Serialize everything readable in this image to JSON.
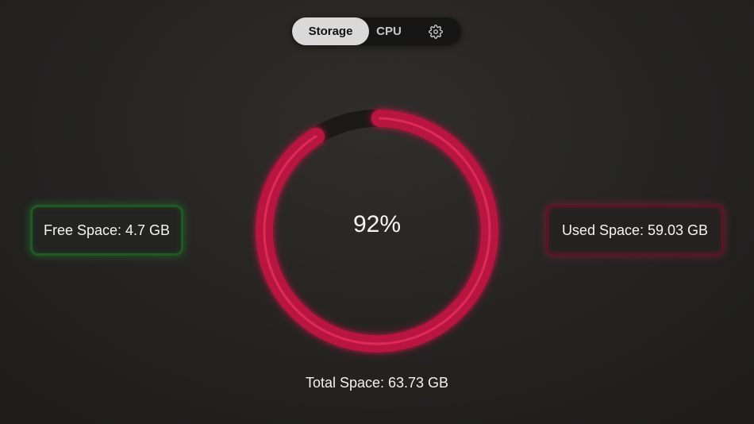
{
  "tabs": [
    {
      "label": "Storage",
      "selected": true
    },
    {
      "label": "CPU",
      "selected": false
    },
    {
      "icon": "gear-icon"
    }
  ],
  "storage": {
    "free_label": "Free Space: 4.7 GB",
    "used_label": "Used Space: 59.03 GB",
    "total_label": "Total Space: 63.73 GB",
    "percent_label": "92%",
    "used_fraction": 0.92
  },
  "colors": {
    "ring": "#b8123f",
    "ring_glow": "#ff3d6b",
    "ring_track": "#1a1918",
    "free_accent": "#2fa83a",
    "used_accent": "#c81e46"
  }
}
